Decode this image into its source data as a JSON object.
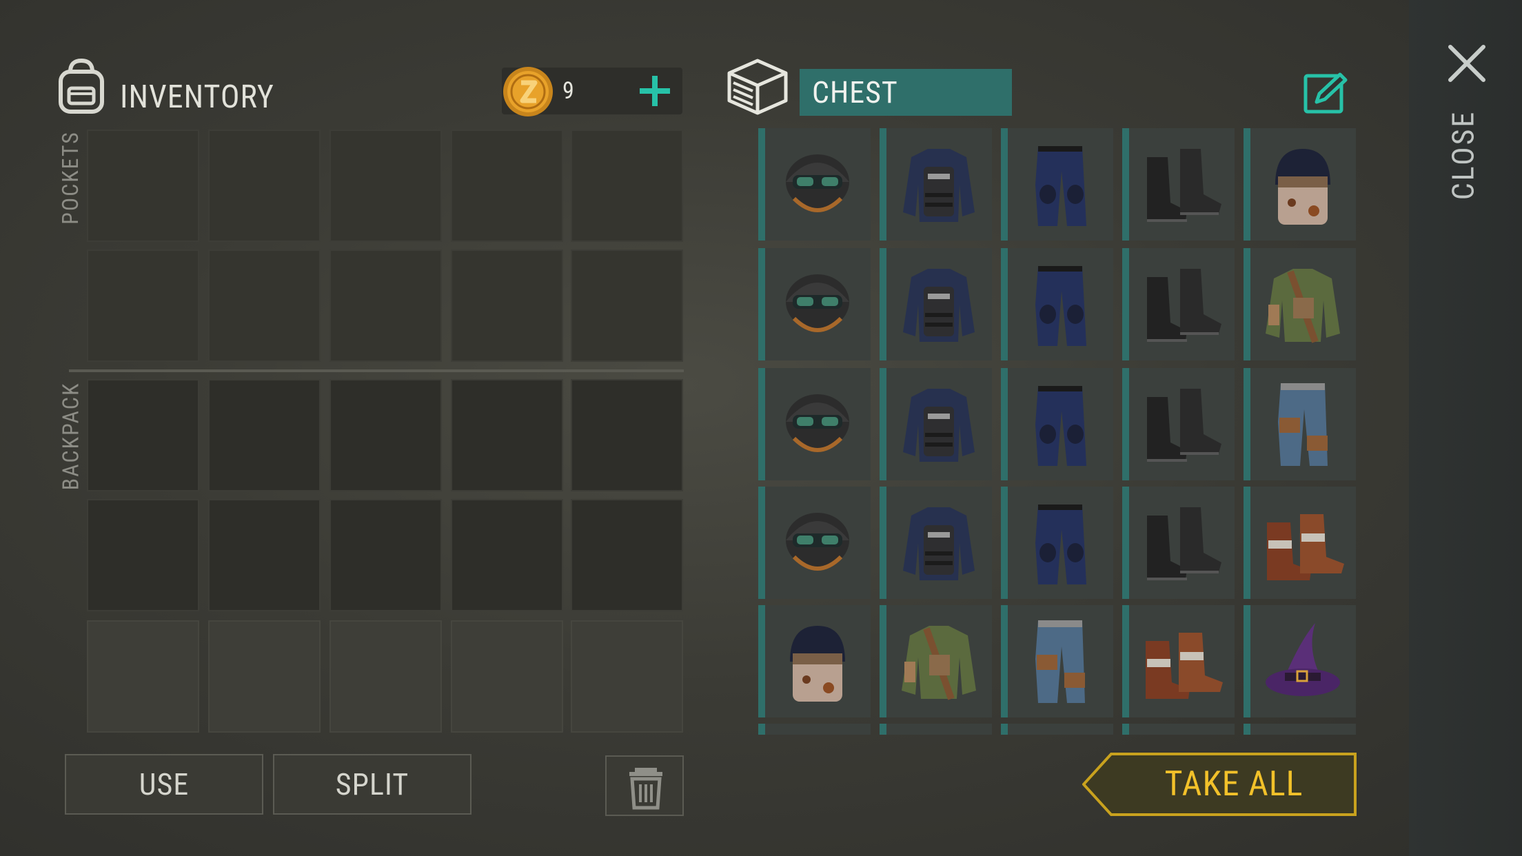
{
  "inventory": {
    "title": "INVENTORY",
    "coins": "9",
    "pockets_label": "POCKETS",
    "backpack_label": "BACKPACK"
  },
  "chest": {
    "title": "CHEST",
    "grid": [
      [
        "police-helmet",
        "police-vest",
        "police-pants",
        "police-boots",
        "makeshift-helmet"
      ],
      [
        "police-helmet",
        "police-vest",
        "police-pants",
        "police-boots",
        "makeshift-jacket"
      ],
      [
        "police-helmet",
        "police-vest",
        "police-pants",
        "police-boots",
        "makeshift-pants"
      ],
      [
        "police-helmet",
        "police-vest",
        "police-pants",
        "police-boots",
        "makeshift-boots"
      ],
      [
        "makeshift-helmet",
        "makeshift-jacket",
        "makeshift-pants",
        "makeshift-boots",
        "witch-hat"
      ]
    ]
  },
  "buttons": {
    "use": "USE",
    "split": "SPLIT",
    "take_all": "TAKE ALL",
    "close": "CLOSE"
  },
  "colors": {
    "accent_teal": "#2f6f6a",
    "gold": "#f2c12a",
    "background": "#3b3b35"
  }
}
